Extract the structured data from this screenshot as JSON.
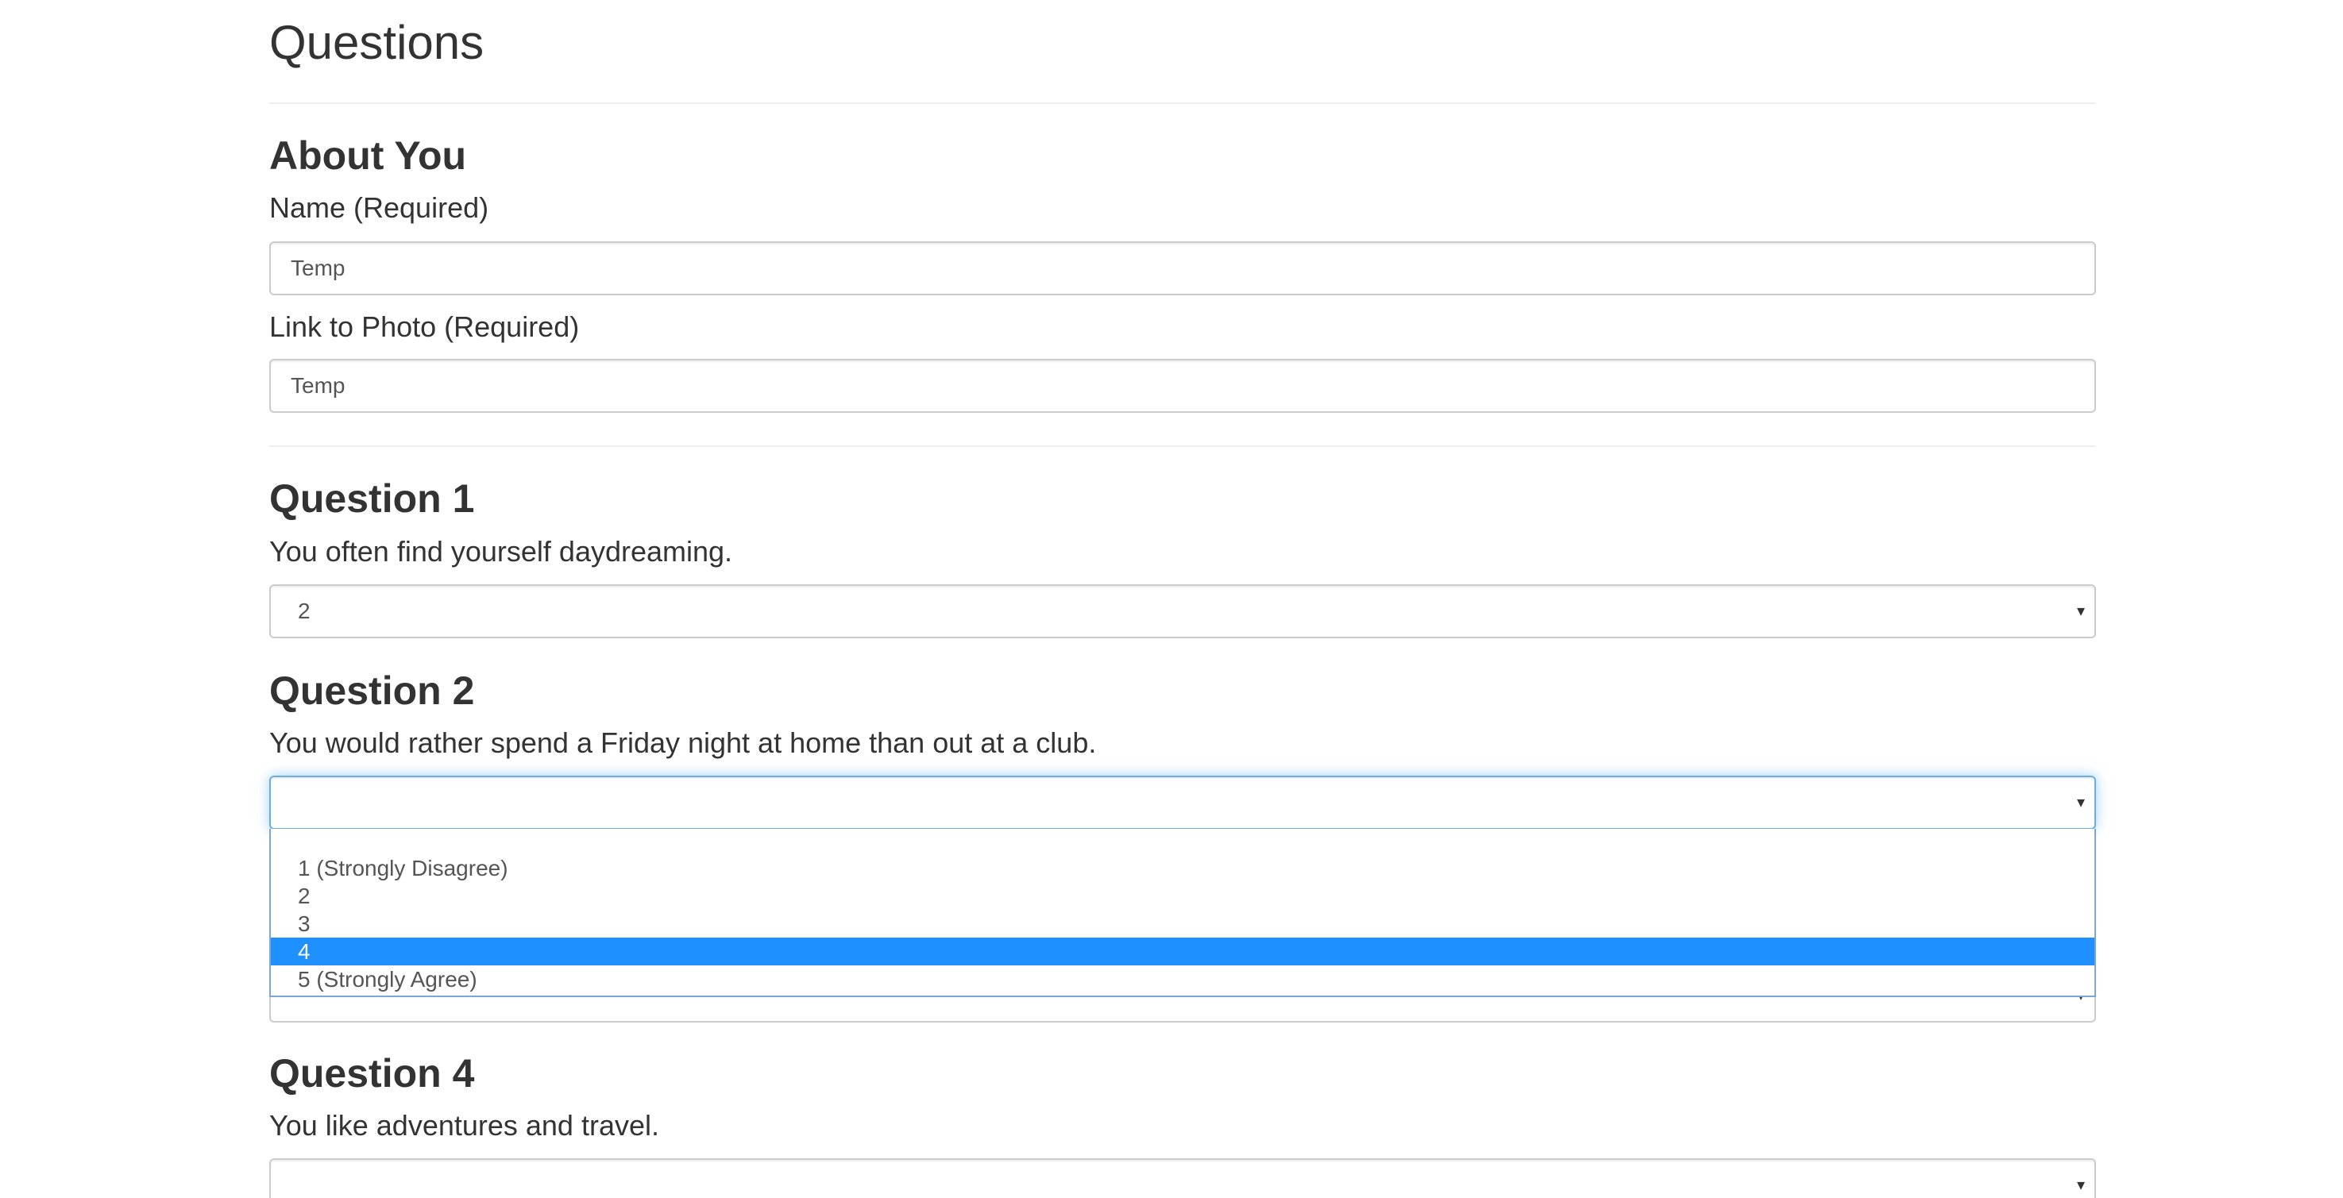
{
  "page": {
    "title": "Questions"
  },
  "about": {
    "heading": "About You",
    "name_label": "Name (Required)",
    "name_value": "Temp",
    "photo_label": "Link to Photo (Required)",
    "photo_value": "Temp"
  },
  "questions": [
    {
      "heading": "Question 1",
      "text": "You often find yourself daydreaming.",
      "selected": "2"
    },
    {
      "heading": "Question 2",
      "text": "You would rather spend a Friday night at home than out at a club.",
      "selected": "",
      "options": [
        "",
        "1 (Strongly Disagree)",
        "2",
        "3",
        "4",
        "5 (Strongly Agree)"
      ],
      "highlighted": "4"
    },
    {
      "heading": "Question 4",
      "text": "You like adventures and travel.",
      "selected": ""
    }
  ],
  "icons": {
    "select_caret": "▾"
  },
  "colors": {
    "highlight": "#1e90ff",
    "focus_border": "#66afe9"
  }
}
